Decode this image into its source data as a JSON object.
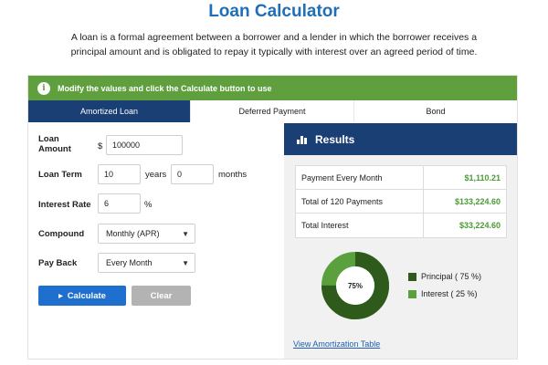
{
  "page": {
    "title": "Loan Calculator",
    "intro": "A loan is a formal agreement between a borrower and a lender in which the borrower receives a principal amount and is obligated to repay it typically with interest over an agreed period of time."
  },
  "notice": {
    "text": "Modify the values and click the Calculate button to use",
    "icon": "info-icon"
  },
  "tabs": [
    {
      "label": "Amortized Loan",
      "active": true
    },
    {
      "label": "Deferred Payment",
      "active": false
    },
    {
      "label": "Bond",
      "active": false
    }
  ],
  "form": {
    "loan_amount": {
      "label": "Loan Amount",
      "currency": "$",
      "value": "100000"
    },
    "loan_term": {
      "label": "Loan Term",
      "years_value": "10",
      "years_unit": "years",
      "months_value": "0",
      "months_unit": "months"
    },
    "interest_rate": {
      "label": "Interest Rate",
      "value": "6",
      "unit": "%"
    },
    "compound": {
      "label": "Compound",
      "selected": "Monthly (APR)"
    },
    "pay_back": {
      "label": "Pay Back",
      "selected": "Every Month"
    },
    "calculate_label": "Calculate",
    "clear_label": "Clear"
  },
  "results": {
    "title": "Results",
    "rows": [
      {
        "label": "Payment Every Month",
        "value": "$1,110.21"
      },
      {
        "label": "Total of 120 Payments",
        "value": "$133,224.60"
      },
      {
        "label": "Total Interest",
        "value": "$33,224.60"
      }
    ],
    "donut": {
      "center_label": "75%",
      "principal_fraction": 0.75,
      "principal_color": "#2e5a1c",
      "interest_color": "#5aa03c"
    },
    "legend": [
      {
        "label": "Principal (  75  %)",
        "color": "#2e5a1c"
      },
      {
        "label": "Interest (  25  %)",
        "color": "#5aa03c"
      }
    ],
    "link": "View Amortization Table"
  },
  "colors": {
    "accent_blue": "#1f6fb8",
    "navy": "#1a3f75",
    "green": "#5f9f3e",
    "value_green": "#4a9a35"
  }
}
